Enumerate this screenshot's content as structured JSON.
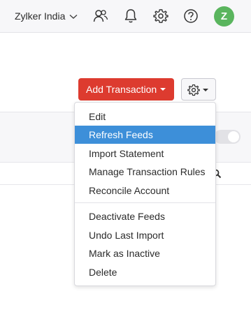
{
  "header": {
    "org_name": "Zylker India",
    "avatar_letter": "Z",
    "avatar_color": "#5ab55e",
    "icons": [
      "chevron-down-icon",
      "users-icon",
      "bell-icon",
      "gear-icon",
      "help-icon"
    ]
  },
  "toolbar": {
    "add_transaction_label": "Add Transaction",
    "add_color": "#dd3b2f"
  },
  "menu": {
    "items": [
      {
        "label": "Edit"
      },
      {
        "label": "Refresh Feeds",
        "active": true
      },
      {
        "label": "Import Statement"
      },
      {
        "label": "Manage Transaction Rules"
      },
      {
        "label": "Reconcile Account"
      },
      {
        "label": "Deactivate Feeds"
      },
      {
        "label": "Undo Last Import"
      },
      {
        "label": "Mark as Inactive"
      },
      {
        "label": "Delete"
      }
    ],
    "highlight_color": "#3d8fd9"
  }
}
